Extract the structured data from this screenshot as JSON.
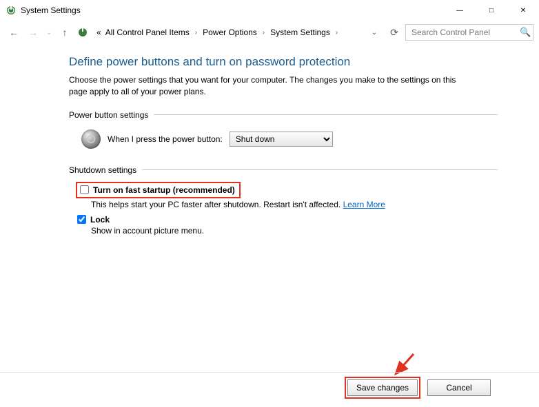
{
  "window": {
    "title": "System Settings",
    "controls": {
      "minimize": "—",
      "maximize": "□",
      "close": "✕"
    }
  },
  "toolbar": {
    "back": "←",
    "forward": "→",
    "recent": "⌄",
    "up": "↑",
    "refresh": "⟳",
    "addr_dropdown": "⌄"
  },
  "breadcrumb": {
    "prefix": "«",
    "items": [
      "All Control Panel Items",
      "Power Options",
      "System Settings"
    ]
  },
  "search": {
    "placeholder": "Search Control Panel"
  },
  "page": {
    "title": "Define power buttons and turn on password protection",
    "description": "Choose the power settings that you want for your computer. The changes you make to the settings on this page apply to all of your power plans."
  },
  "sections": {
    "power_button": {
      "header": "Power button settings",
      "label": "When I press the power button:",
      "options": [
        "Shut down"
      ],
      "selected": "Shut down"
    },
    "shutdown": {
      "header": "Shutdown settings",
      "fast_startup": {
        "checked": false,
        "label": "Turn on fast startup (recommended)",
        "sub": "This helps start your PC faster after shutdown. Restart isn't affected. ",
        "link": "Learn More"
      },
      "lock": {
        "checked": true,
        "label": "Lock",
        "sub": "Show in account picture menu."
      }
    }
  },
  "buttons": {
    "save": "Save changes",
    "cancel": "Cancel"
  }
}
